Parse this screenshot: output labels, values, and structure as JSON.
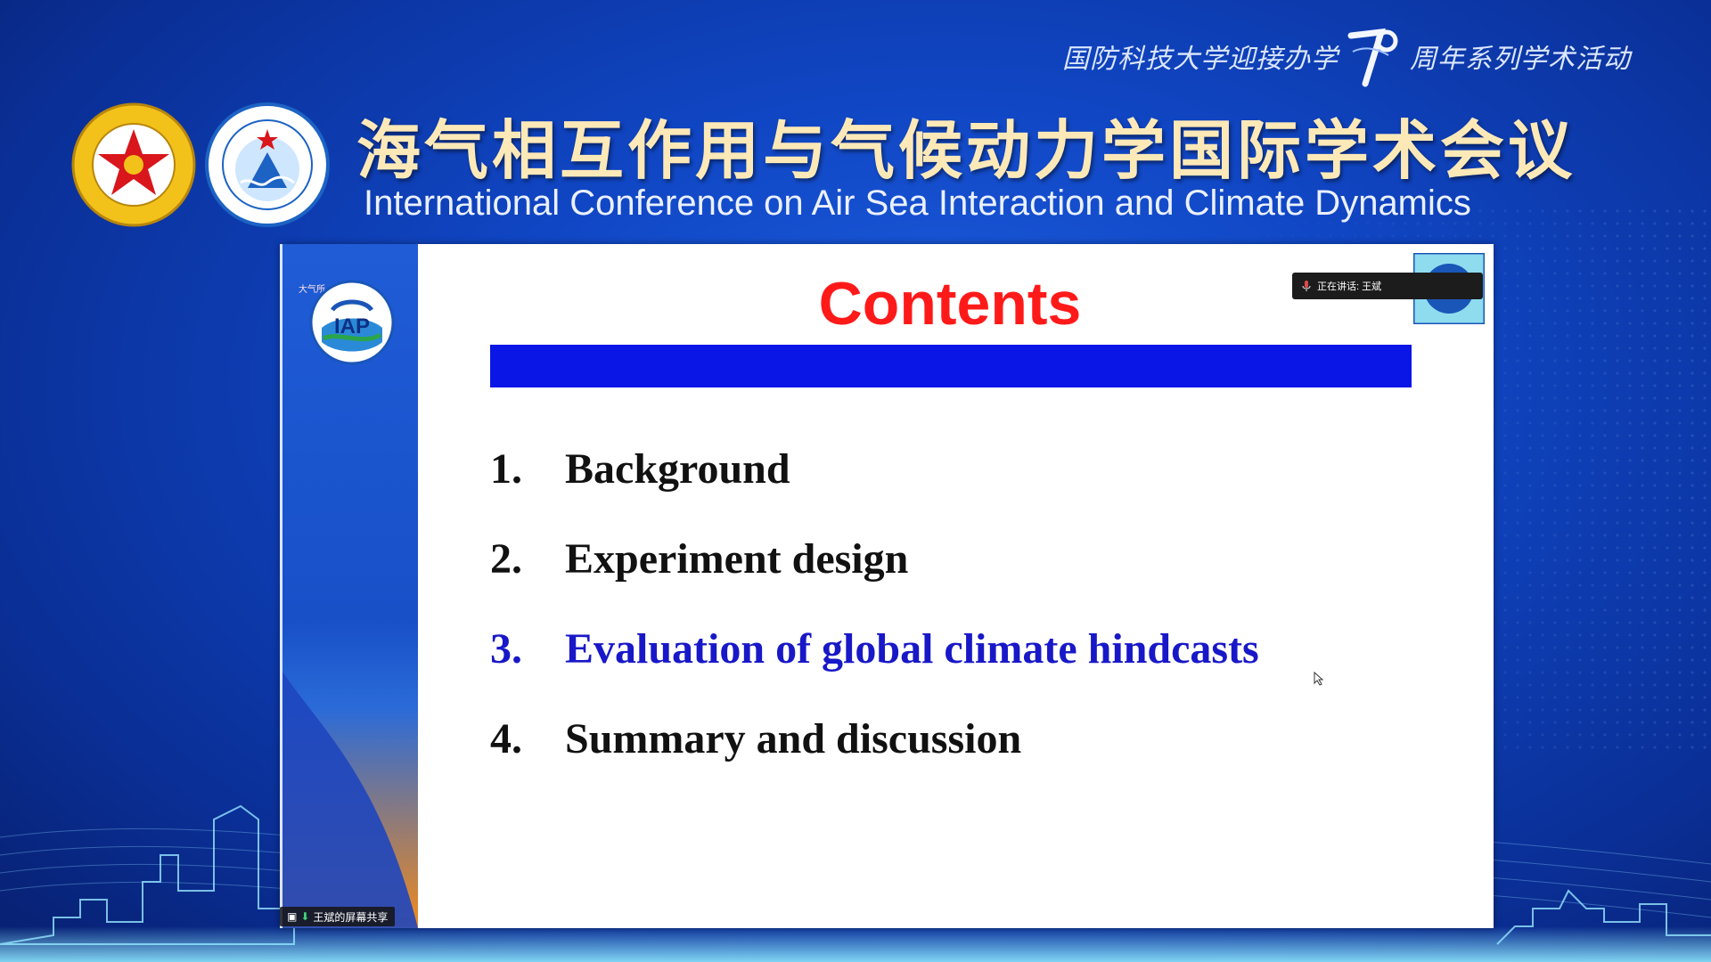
{
  "banner": {
    "event_line_left": "国防科技大学迎接办学",
    "event_number": "70",
    "event_line_right": "周年系列学术活动",
    "title_cn": "海气相互作用与气候动力学国际学术会议",
    "title_en": "International Conference on Air Sea Interaction and Climate Dynamics"
  },
  "logos": {
    "left_icon": "national-university-of-defense-technology-seal",
    "right_icon": "college-of-meteorology-and-oceanography-seal",
    "slide_icon": "iap-cas-logo"
  },
  "slide": {
    "title": "Contents",
    "items": [
      {
        "num": "1.",
        "label": "Background"
      },
      {
        "num": "2.",
        "label": "Experiment design"
      },
      {
        "num": "3.",
        "label": "Evaluation of global climate hindcasts"
      },
      {
        "num": "4.",
        "label": "Summary and discussion"
      }
    ],
    "active_index": 2,
    "slide_tag": "大气所"
  },
  "overlay": {
    "speaking_label": "正在讲话: 王斌",
    "share_label": "王斌的屏幕共享"
  },
  "colors": {
    "title_red": "#ff1a1a",
    "bar_blue": "#0a16e6",
    "active_item": "#1818c8",
    "banner_gold": "#fde9b8"
  }
}
